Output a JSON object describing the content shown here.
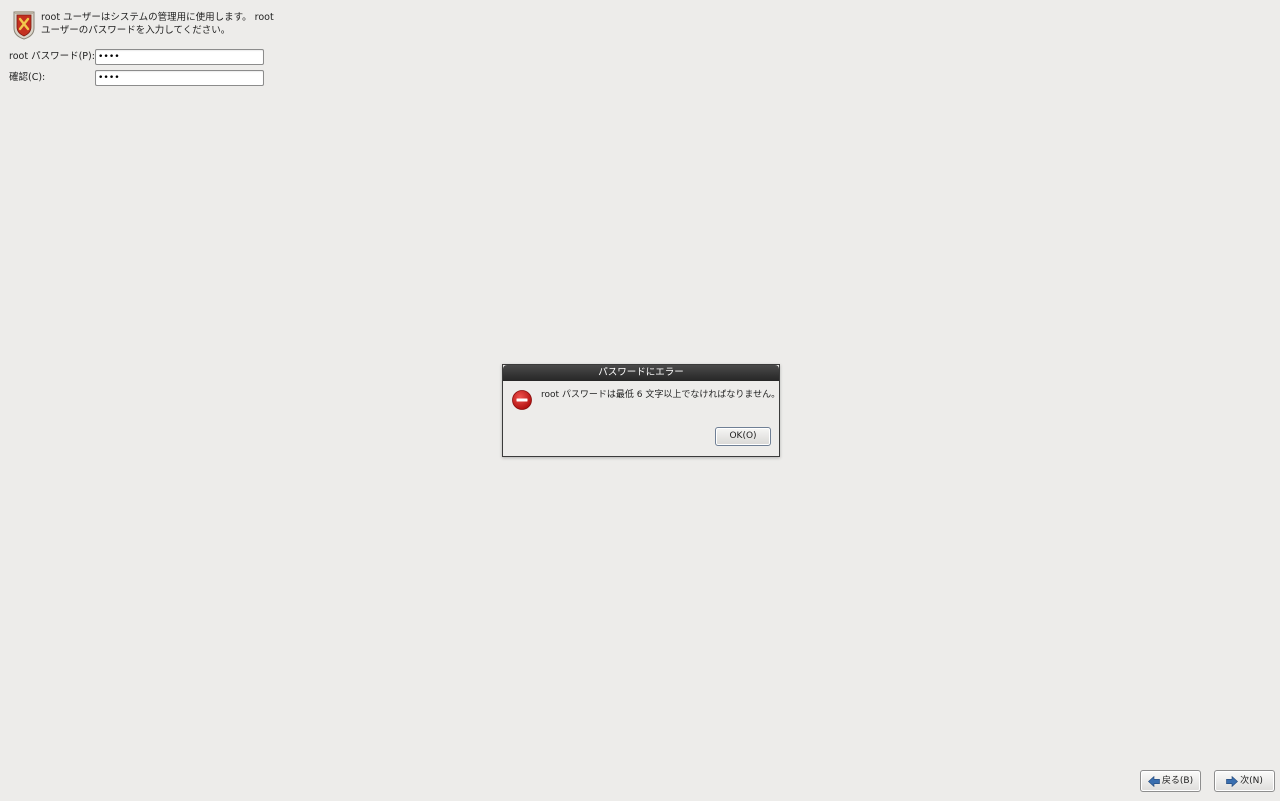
{
  "header": {
    "icon": "root-shield-icon",
    "description": "root ユーザーはシステムの管理用に使用します。 root ユーザーのパスワードを入力してください。"
  },
  "form": {
    "password_label": "root パスワード(P):",
    "password_value": "••••",
    "confirm_label": "確認(C):",
    "confirm_value": "••••"
  },
  "dialog": {
    "title": "パスワードにエラー",
    "icon": "error-icon",
    "message": "root パスワードは最低 6 文字以上でなければなりません。",
    "ok_label": "OK(O)"
  },
  "nav": {
    "back_label": "戻る(B)",
    "next_label": "次(N)",
    "back_icon": "arrow-left-icon",
    "next_icon": "arrow-right-icon"
  },
  "colors": {
    "background": "#edecea",
    "titlebar": "#2e2e2e",
    "error_red": "#c8161d",
    "arrow_blue": "#3a6fb0"
  }
}
